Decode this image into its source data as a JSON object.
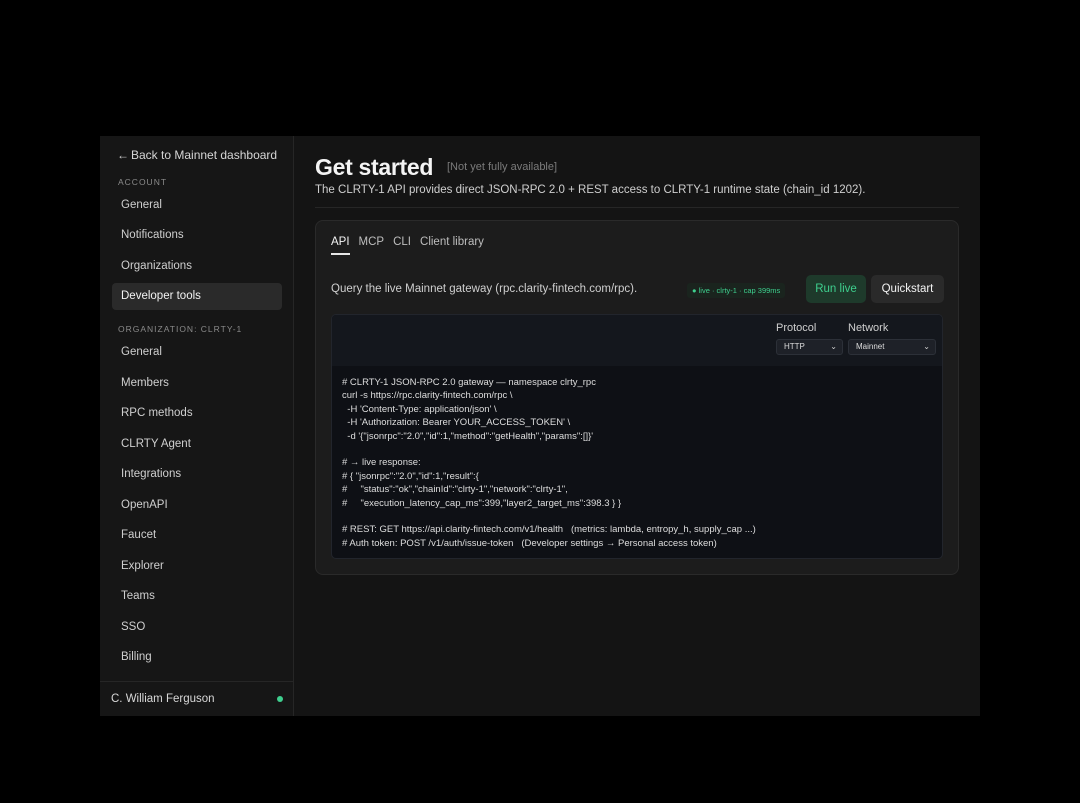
{
  "sidebar": {
    "back_label": "Back to Mainnet dashboard",
    "account_label": "ACCOUNT",
    "account_items": [
      "General",
      "Notifications",
      "Organizations",
      "Developer tools"
    ],
    "org_label": "ORGANIZATION: CLRTY-1",
    "org_items": [
      "General",
      "Members",
      "RPC methods",
      "CLRTY Agent",
      "Integrations",
      "OpenAPI",
      "Faucet",
      "Explorer",
      "Teams",
      "SSO",
      "Billing"
    ],
    "user_name": "C. William Ferguson",
    "status_color": "#3ecf8e"
  },
  "header": {
    "title": "Get started",
    "tag": "[Not yet fully available]",
    "description": "The CLRTY-1 API provides direct JSON-RPC 2.0 + REST access to CLRTY-1 runtime state (chain_id 1202)."
  },
  "card": {
    "tabs": [
      "API",
      "MCP",
      "CLI",
      "Client library"
    ],
    "query_text": "Query the live Mainnet gateway (rpc.clarity-fintech.com/rpc).",
    "live_badge": "● live · clrty-1 · cap 399ms",
    "run_label": "Run live",
    "quickstart_label": "Quickstart",
    "protocol_label": "Protocol",
    "protocol_value": "HTTP",
    "network_label": "Network",
    "network_value": "Mainnet",
    "code": "# CLRTY-1 JSON-RPC 2.0 gateway — namespace clrty_rpc\ncurl -s https://rpc.clarity-fintech.com/rpc \\\n  -H 'Content-Type: application/json' \\\n  -H 'Authorization: Bearer YOUR_ACCESS_TOKEN' \\\n  -d '{\"jsonrpc\":\"2.0\",\"id\":1,\"method\":\"getHealth\",\"params\":[]}'\n\n# → live response:\n# { \"jsonrpc\":\"2.0\",\"id\":1,\"result\":{\n#     \"status\":\"ok\",\"chainId\":\"clrty-1\",\"network\":\"clrty-1\",\n#     \"execution_latency_cap_ms\":399,\"layer2_target_ms\":398.3 } }\n\n# REST: GET https://api.clarity-fintech.com/v1/health   (metrics: lambda, entropy_h, supply_cap ...)\n# Auth token: POST /v1/auth/issue-token   (Developer settings → Personal access token)"
  },
  "colors": {
    "accent_green": "#3ecf8e",
    "background": "#141414"
  }
}
